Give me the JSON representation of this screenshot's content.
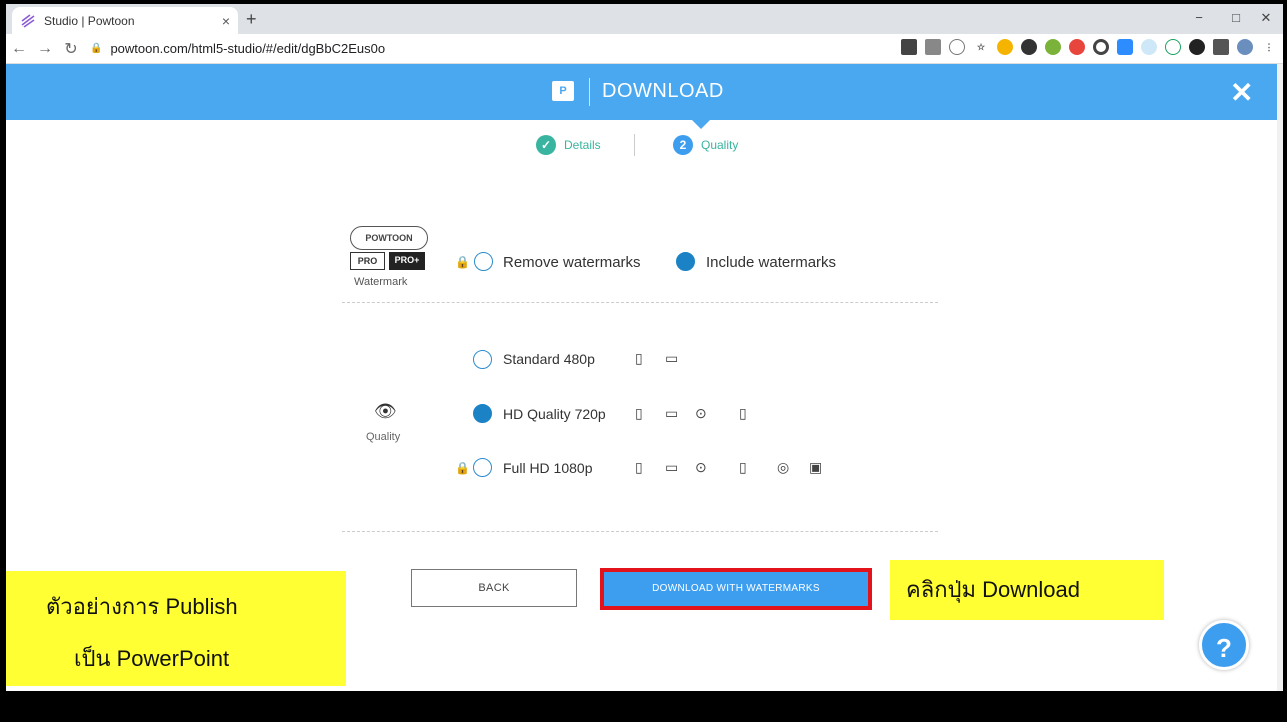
{
  "browser": {
    "tab_title": "Studio | Powtoon",
    "tab_close": "×",
    "new_tab": "+",
    "url": "powtoon.com/html5-studio/#/edit/dgBbC2Eus0o",
    "window_controls": [
      "−",
      "□",
      "✕"
    ]
  },
  "header": {
    "logo": "P",
    "title": "DOWNLOAD",
    "close": "✕"
  },
  "steps": [
    {
      "marker": "✓",
      "label": "Details"
    },
    {
      "marker": "2",
      "label": "Quality"
    }
  ],
  "watermark": {
    "badge": "POWTOON",
    "plans": [
      "PRO",
      "PRO+"
    ],
    "label": "Watermark",
    "options": [
      {
        "label": "Remove watermarks",
        "selected": false,
        "locked": true
      },
      {
        "label": "Include watermarks",
        "selected": true,
        "locked": false
      }
    ]
  },
  "quality": {
    "label": "Quality",
    "options": [
      {
        "label": "Standard 480p",
        "selected": false,
        "locked": false
      },
      {
        "label": "HD Quality 720p",
        "selected": true,
        "locked": false
      },
      {
        "label": "Full HD 1080p",
        "selected": false,
        "locked": true
      }
    ]
  },
  "buttons": {
    "back": "BACK",
    "download": "DOWNLOAD WITH WATERMARKS"
  },
  "callouts": {
    "left_line1": "ตัวอย่างการ Publish",
    "left_line2": "เป็น PowerPoint",
    "right": "คลิกปุ่ม Download"
  },
  "help": "?",
  "colors": {
    "header_blue": "#4aa8f0",
    "accent_teal": "#39b4a0",
    "radio_blue": "#1b82c5",
    "highlight_red": "#e3131c",
    "callout_yellow": "#ffff33"
  }
}
